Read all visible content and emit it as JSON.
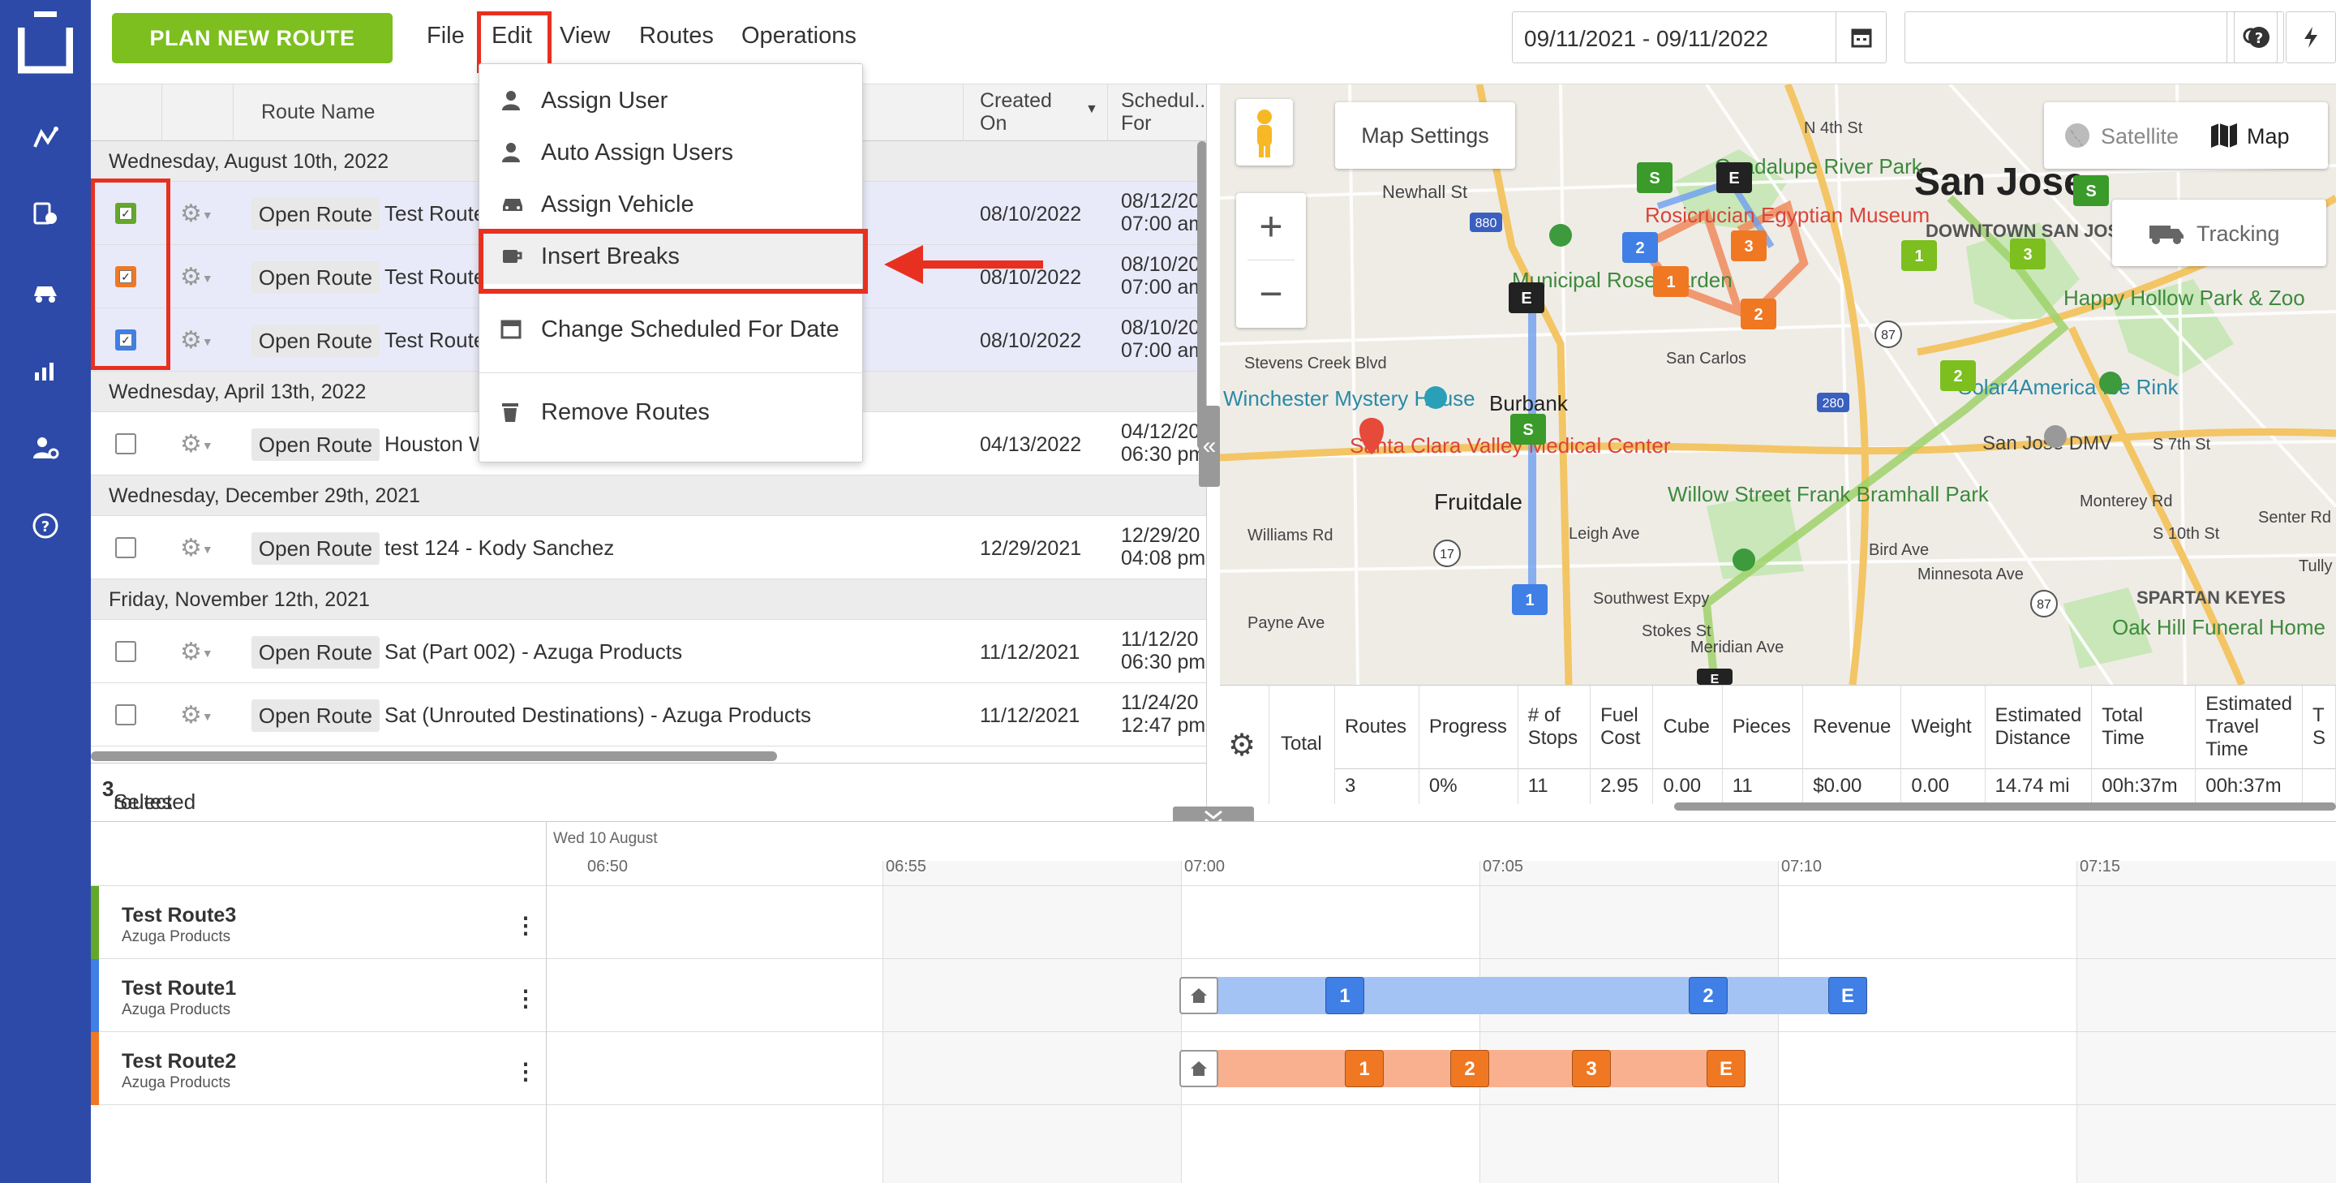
{
  "toolbar": {
    "plan_button": "PLAN NEW ROUTE",
    "menus": [
      "File",
      "Edit",
      "View",
      "Routes",
      "Operations"
    ],
    "date_range": "09/11/2021 - 09/11/2022",
    "search_value": ""
  },
  "grid": {
    "columns": {
      "route_name": "Route Name",
      "created_on": "Created On",
      "scheduled_for": "Schedul... For"
    },
    "groups": [
      {
        "date": "Wednesday, August 10th, 2022",
        "rows": [
          {
            "name": "Test Route",
            "created": "08/10/2022",
            "sched_date": "08/12/20",
            "sched_time": "07:00 am",
            "color": "#64a82a",
            "checked": true
          },
          {
            "name": "Test Route",
            "created": "08/10/2022",
            "sched_date": "08/10/20",
            "sched_time": "07:00 am",
            "color": "#f07823",
            "checked": true
          },
          {
            "name": "Test Route",
            "created": "08/10/2022",
            "sched_date": "08/10/20",
            "sched_time": "07:00 am",
            "color": "#3f7fe6",
            "checked": true
          }
        ]
      },
      {
        "date": "Wednesday, April 13th, 2022",
        "rows": [
          {
            "name": "Houston W",
            "created": "04/13/2022",
            "sched_date": "04/12/20",
            "sched_time": "06:30 pm",
            "checked": false
          }
        ]
      },
      {
        "date": "Wednesday, December 29th, 2021",
        "rows": [
          {
            "name": "test 124 - Kody Sanchez",
            "created": "12/29/2021",
            "sched_date": "12/29/20",
            "sched_time": "04:08 pm",
            "checked": false
          }
        ]
      },
      {
        "date": "Friday, November 12th, 2021",
        "rows": [
          {
            "name": "Sat (Part 002) - Azuga Products",
            "created": "11/12/2021",
            "sched_date": "11/12/20",
            "sched_time": "06:30 pm",
            "checked": false
          },
          {
            "name": "Sat (Unrouted Destinations) - Azuga Products",
            "created": "11/12/2021",
            "sched_date": "11/24/20",
            "sched_time": "12:47 pm",
            "checked": false
          }
        ]
      }
    ],
    "open_route_label": "Open Route",
    "footer_prefix": "Selected",
    "footer_count": "3",
    "footer_suffix": "routes"
  },
  "edit_menu": {
    "items": [
      "Assign User",
      "Auto Assign Users",
      "Assign Vehicle",
      "Insert Breaks",
      "Change Scheduled For Date",
      "Remove Routes"
    ]
  },
  "map": {
    "map_settings": "Map Settings",
    "satellite": "Satellite",
    "map": "Map",
    "tracking": "Tracking",
    "labels": {
      "san_jose": "San Jose",
      "downtown": "DOWNTOWN SAN JOSE SOFA",
      "guadalupe": "Guadalupe River Park",
      "rosicrucian": "Rosicrucian Egyptian Museum",
      "municipal": "Municipal Rose Garden",
      "newhall": "Newhall St",
      "stevens": "Stevens Creek Blvd",
      "winchester": "Winchester Mystery House",
      "burbank": "Burbank",
      "santa_clara": "Santa Clara Valley Medical Center",
      "fruitdale": "Fruitdale",
      "williams": "Williams Rd",
      "payne": "Payne Ave",
      "willow": "Willow Street Frank Bramhall Park",
      "happy": "Happy Hollow Park & Zoo",
      "solar": "Solar4America Ice Rink",
      "dmv": "San Jose DMV",
      "spartan": "SPARTAN KEYES",
      "oak": "Oak Hill Funeral Home",
      "san_carlos": "San Carlos",
      "minnesota": "Minnesota Ave",
      "southwest": "Southwest Expy",
      "leigh": "Leigh Ave",
      "meridian": "Meridian Ave",
      "bird": "Bird Ave",
      "stokes": "Stokes St",
      "monterey": "Monterey Rd",
      "n4": "N 4th St",
      "s10": "S 10th St",
      "s7": "S 7th St",
      "senter": "Senter Rd",
      "tully": "Tully R",
      "hwy880": "880",
      "hwy87": "87",
      "hwy280": "280",
      "hwy17": "17"
    }
  },
  "stats": {
    "total_label": "Total",
    "headers": [
      "Routes",
      "Progress",
      "# of Stops",
      "Fuel Cost",
      "Cube",
      "Pieces",
      "Revenue",
      "Weight",
      "Estimated Distance",
      "Total Time",
      "Estimated Travel Time",
      "T S"
    ],
    "values": [
      "3",
      "0%",
      "11",
      "2.95",
      "0.00",
      "11",
      "$0.00",
      "0.00",
      "14.74 mi",
      "00h:37m",
      "00h:37m",
      ""
    ]
  },
  "gantt": {
    "day_label": "Wed 10 August",
    "ticks": [
      "06:50",
      "06:55",
      "07:00",
      "07:05",
      "07:10",
      "07:15"
    ],
    "routes": [
      {
        "name": "Test Route3",
        "org": "Azuga Products",
        "color": "#64a82a",
        "stops": []
      },
      {
        "name": "Test Route1",
        "org": "Azuga Products",
        "color": "#3f7fe6",
        "stops": [
          "1",
          "2",
          "E"
        ]
      },
      {
        "name": "Test Route2",
        "org": "Azuga Products",
        "color": "#f07823",
        "stops": [
          "1",
          "2",
          "3",
          "E"
        ]
      }
    ]
  },
  "colors": {
    "sidebar": "#2d4aa8",
    "accent_green": "#7cbf1e",
    "highlight_red": "#e83020",
    "route_blue": "#3f7fe6",
    "route_orange": "#f07823",
    "route_green": "#64a82a"
  }
}
